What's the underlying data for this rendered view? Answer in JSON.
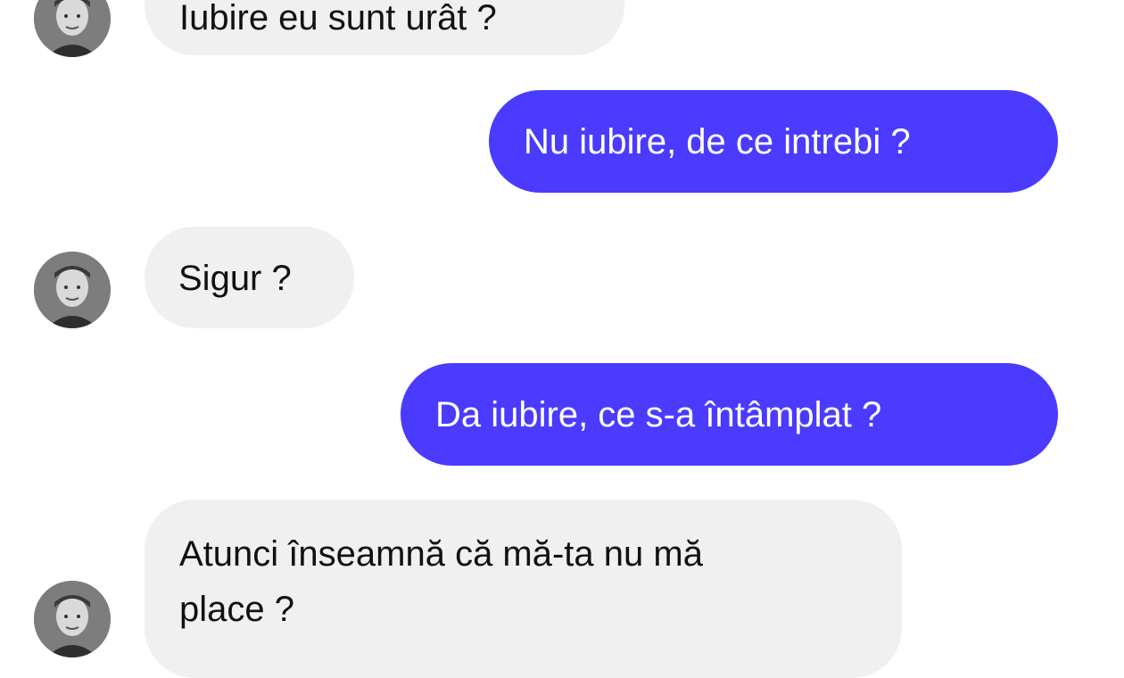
{
  "colors": {
    "incoming_bubble": "#f0f0f0",
    "outgoing_bubble": "#4a3bff",
    "background": "#ffffff"
  },
  "messages": [
    {
      "direction": "incoming",
      "text": "Iubire eu sunt urât ?"
    },
    {
      "direction": "outgoing",
      "text": "Nu iubire, de ce intrebi ?"
    },
    {
      "direction": "incoming",
      "text": "Sigur ?"
    },
    {
      "direction": "outgoing",
      "text": "Da iubire, ce s-a întâmplat  ?"
    },
    {
      "direction": "incoming",
      "lines": [
        "Atunci înseamnă că mă-ta nu mă",
        "place ?"
      ]
    }
  ],
  "avatar_icon": "contact-avatar-photo"
}
